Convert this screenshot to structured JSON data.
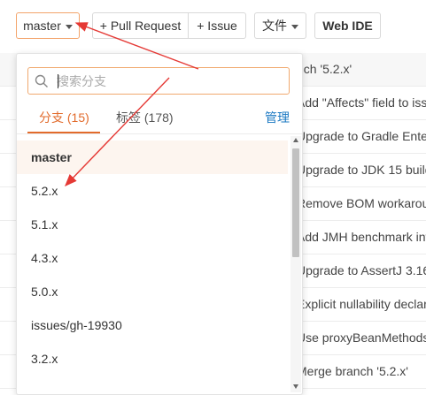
{
  "toolbar": {
    "branch_label": "master",
    "pull_request_label": "+ Pull Request",
    "issue_label": "+ Issue",
    "files_label": "文件",
    "web_ide_label": "Web IDE"
  },
  "commits": [
    "nch '5.2.x'",
    "Add \"Affects\" field to iss",
    "Upgrade to Gradle Ente",
    "Upgrade to JDK 15 build",
    "Remove BOM workarou",
    "Add JMH benchmark inf",
    "Upgrade to AssertJ 3.16",
    "Explicit nullability declar",
    "Use proxyBeanMethods",
    "Merge branch '5.2.x'"
  ],
  "dropdown": {
    "search_placeholder": "搜索分支",
    "tab_branches": "分支 (15)",
    "tab_tags": "标签 (178)",
    "manage_label": "管理",
    "branches": [
      "master",
      "5.2.x",
      "5.1.x",
      "4.3.x",
      "5.0.x",
      "issues/gh-19930",
      "3.2.x"
    ]
  },
  "colors": {
    "accent": "#e26b2c",
    "link": "#1a78c2",
    "annotation_arrow": "#e53935"
  }
}
